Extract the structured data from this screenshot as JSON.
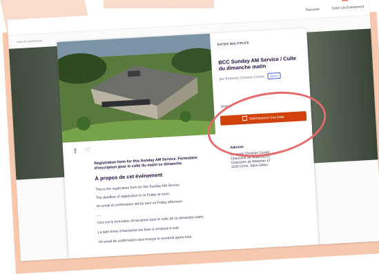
{
  "topbar": {
    "nav": [
      "Parcourir",
      "Créer Un Événement"
    ]
  },
  "breadcrumb": "Infos de l'événement",
  "event": {
    "date_label": "DATES MULTIPLES",
    "title": "BCC Sunday AM Service / Culte du dimanche matin",
    "organizer_prefix": "par Brussels Christian Center",
    "follow_label": "Suivre",
    "price": "Gratuit",
    "cta_label": "Sélectionnez Une Date"
  },
  "intro": "Registration form for this Sunday AM Service. Formulaire d'inscription pour le culte du matin ce dimanche.",
  "about": {
    "heading": "À propos de cet événement",
    "lines": [
      "This is the registration form for this Sunday AM Service.",
      "The deadline of registration is on Friday at noon.",
      "An email of confirmation will be sent on Friday afternoon.",
      "---",
      "Ceci est le formulaire d'inscription pour le culte de ce dimanche matin.",
      "La date limite d'inscription est fixée à vendredi à midi.",
      "Un email de confirmation sera envoyé le vendredi après-midi."
    ]
  },
  "location": {
    "heading": "Adresse",
    "lines": [
      "Brussels Christian Center",
      "Chaussée de Waterloo 67",
      "Chaussée de Waterloo 67",
      "1180 Uccle, Saint-Gilles"
    ]
  },
  "colors": {
    "accent": "#d1410c",
    "annotation": "#e76a6a",
    "background_decor": "#f9dccb"
  },
  "icons": [
    "share-icon",
    "heart-icon",
    "calendar-icon"
  ]
}
